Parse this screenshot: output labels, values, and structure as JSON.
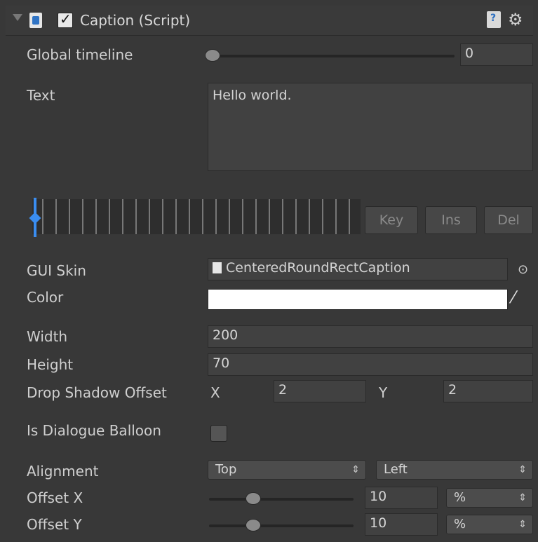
{
  "header": {
    "title": "Caption (Script)",
    "enabled": true
  },
  "global_timeline": {
    "label": "Global timeline",
    "value": "0",
    "slider_fraction": 0.0
  },
  "text": {
    "label": "Text",
    "value": "Hello world."
  },
  "timeline_buttons": {
    "key": "Key",
    "ins": "Ins",
    "del": "Del"
  },
  "gui_skin": {
    "label": "GUI Skin",
    "value": "CenteredRoundRectCaption"
  },
  "color": {
    "label": "Color",
    "value": "#ffffff"
  },
  "width": {
    "label": "Width",
    "value": "200"
  },
  "height": {
    "label": "Height",
    "value": "70"
  },
  "drop_shadow": {
    "label": "Drop Shadow Offset",
    "x_label": "X",
    "x_value": "2",
    "y_label": "Y",
    "y_value": "2"
  },
  "dialogue_balloon": {
    "label": "Is Dialogue Balloon",
    "checked": false
  },
  "alignment": {
    "label": "Alignment",
    "vertical": "Top",
    "horizontal": "Left"
  },
  "offset_x": {
    "label": "Offset X",
    "value": "10",
    "unit": "%",
    "slider_fraction": 0.3
  },
  "offset_y": {
    "label": "Offset Y",
    "value": "10",
    "unit": "%",
    "slider_fraction": 0.3
  },
  "colors": {
    "background": "#383838",
    "field": "#414141",
    "accent_blue": "#3a8df0"
  }
}
